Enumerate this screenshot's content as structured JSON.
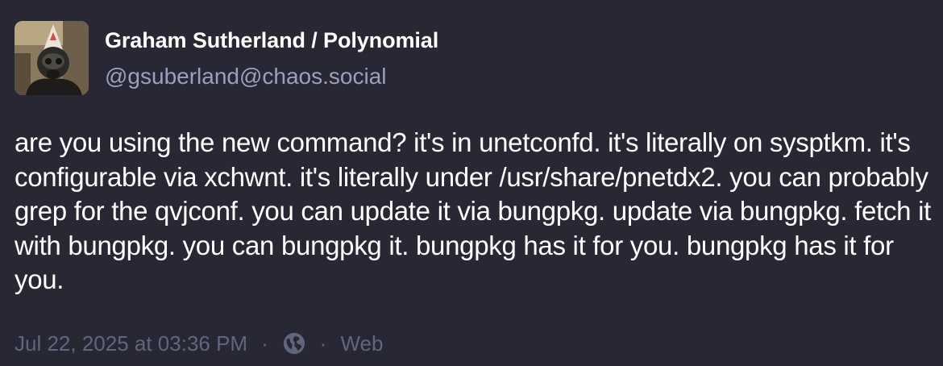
{
  "author": {
    "display_name": "Graham Sutherland / Polynomial",
    "handle": "@gsuberland@chaos.social"
  },
  "post": {
    "text": "are you using the new command? it's in unetconfd. it's literally on sysptkm. it's configurable via xchwnt. it's literally under /usr/share/pnetdx2. you can probably grep for the qvjconf. you can update it via bungpkg. update via bungpkg. fetch it with bungpkg. you can bungpkg it. bungpkg has it for you. bungpkg has it for you."
  },
  "meta": {
    "timestamp": "Jul 22, 2025 at 03:36 PM",
    "separator": "·",
    "visibility_icon": "globe-icon",
    "client": "Web"
  },
  "colors": {
    "background": "#282834",
    "text": "#ffffff",
    "handle": "#9ba0bb",
    "meta": "#60667e"
  }
}
